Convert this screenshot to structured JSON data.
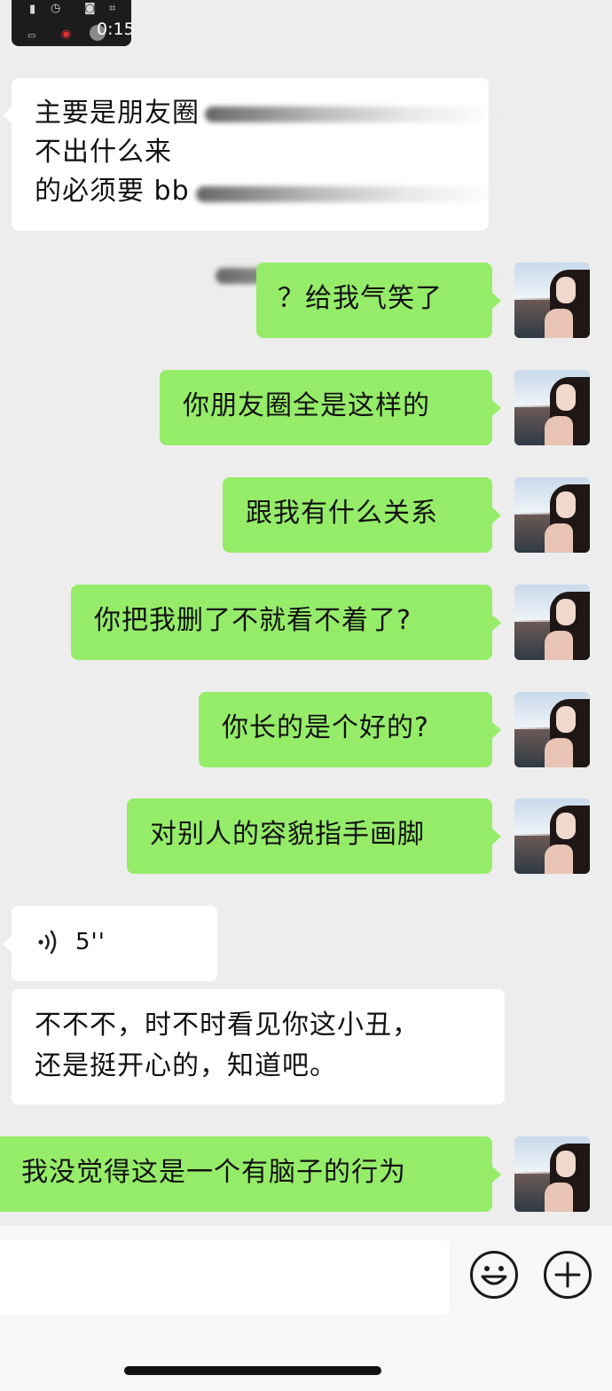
{
  "recording": {
    "time": "0:15"
  },
  "messages": [
    {
      "side": "in",
      "lines": [
        "主要是朋友圈",
        "不出什么来",
        "的必须要 bb"
      ]
    },
    {
      "side": "out",
      "text": "？给我气笑了"
    },
    {
      "side": "out",
      "text": "你朋友圈全是这样的"
    },
    {
      "side": "out",
      "text": "跟我有什么关系"
    },
    {
      "side": "out",
      "text": "你把我删了不就看不着了?"
    },
    {
      "side": "out",
      "text": "你长的是个好的?"
    },
    {
      "side": "out",
      "text": "对别人的容貌指手画脚"
    },
    {
      "side": "in",
      "type": "voice",
      "duration": "5''"
    },
    {
      "side": "in",
      "lines": [
        "不不不，时不时看见你这小丑，",
        "还是挺开心的，知道吧。"
      ]
    },
    {
      "side": "out",
      "text": "我没觉得这是一个有脑子的行为"
    }
  ],
  "colors": {
    "out_bubble": "#95ec69",
    "in_bubble": "#ffffff",
    "background": "#ededed"
  },
  "icons": {
    "emoji": "emoji-face-icon",
    "plus": "plus-circle-icon",
    "voice": "voice-wave-icon"
  }
}
